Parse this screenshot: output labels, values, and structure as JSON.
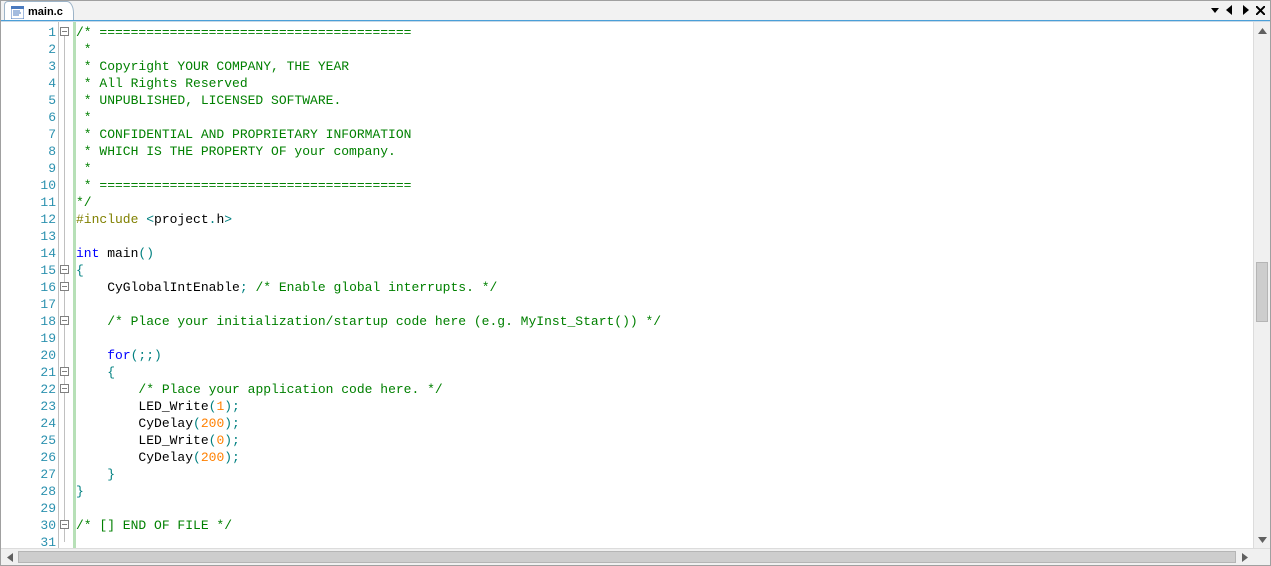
{
  "tab": {
    "label": "main.c",
    "icon": "c-src-icon"
  },
  "tab_controls": {
    "menu": "menu-down-icon",
    "prev": "tab-prev-icon",
    "next": "tab-next-icon",
    "close": "close-icon"
  },
  "gutter": {
    "start": 1,
    "end": 31
  },
  "fold_marks": [
    1,
    15,
    16,
    18,
    21,
    22,
    30
  ],
  "code_lines": [
    {
      "n": 1,
      "tokens": [
        [
          "comment",
          "/* ========================================"
        ]
      ]
    },
    {
      "n": 2,
      "tokens": [
        [
          "comment",
          " *"
        ]
      ]
    },
    {
      "n": 3,
      "tokens": [
        [
          "comment",
          " * Copyright YOUR COMPANY, THE YEAR"
        ]
      ]
    },
    {
      "n": 4,
      "tokens": [
        [
          "comment",
          " * All Rights Reserved"
        ]
      ]
    },
    {
      "n": 5,
      "tokens": [
        [
          "comment",
          " * UNPUBLISHED, LICENSED SOFTWARE."
        ]
      ]
    },
    {
      "n": 6,
      "tokens": [
        [
          "comment",
          " *"
        ]
      ]
    },
    {
      "n": 7,
      "tokens": [
        [
          "comment",
          " * CONFIDENTIAL AND PROPRIETARY INFORMATION"
        ]
      ]
    },
    {
      "n": 8,
      "tokens": [
        [
          "comment",
          " * WHICH IS THE PROPERTY OF your company."
        ]
      ]
    },
    {
      "n": 9,
      "tokens": [
        [
          "comment",
          " *"
        ]
      ]
    },
    {
      "n": 10,
      "tokens": [
        [
          "comment",
          " * ========================================"
        ]
      ]
    },
    {
      "n": 11,
      "tokens": [
        [
          "comment",
          "*/"
        ]
      ]
    },
    {
      "n": 12,
      "tokens": [
        [
          "preproc",
          "#include "
        ],
        [
          "punct",
          "<"
        ],
        [
          "ident",
          "project"
        ],
        [
          "punct",
          "."
        ],
        [
          "ident",
          "h"
        ],
        [
          "punct",
          ">"
        ]
      ]
    },
    {
      "n": 13,
      "tokens": [
        [
          "ident",
          ""
        ]
      ]
    },
    {
      "n": 14,
      "tokens": [
        [
          "keyword",
          "int"
        ],
        [
          "ident",
          " main"
        ],
        [
          "punct",
          "()"
        ]
      ]
    },
    {
      "n": 15,
      "tokens": [
        [
          "punct",
          "{"
        ]
      ]
    },
    {
      "n": 16,
      "tokens": [
        [
          "ident",
          "    CyGlobalIntEnable"
        ],
        [
          "punct",
          ";"
        ],
        [
          "ident",
          " "
        ],
        [
          "comment",
          "/* Enable global interrupts. */"
        ]
      ]
    },
    {
      "n": 17,
      "tokens": [
        [
          "ident",
          ""
        ]
      ]
    },
    {
      "n": 18,
      "tokens": [
        [
          "ident",
          "    "
        ],
        [
          "comment",
          "/* Place your initialization/startup code here (e.g. MyInst_Start()) */"
        ]
      ]
    },
    {
      "n": 19,
      "tokens": [
        [
          "ident",
          ""
        ]
      ]
    },
    {
      "n": 20,
      "tokens": [
        [
          "ident",
          "    "
        ],
        [
          "keyword",
          "for"
        ],
        [
          "punct",
          "(;;)"
        ]
      ]
    },
    {
      "n": 21,
      "tokens": [
        [
          "ident",
          "    "
        ],
        [
          "punct",
          "{"
        ]
      ]
    },
    {
      "n": 22,
      "tokens": [
        [
          "ident",
          "        "
        ],
        [
          "comment",
          "/* Place your application code here. */"
        ]
      ]
    },
    {
      "n": 23,
      "tokens": [
        [
          "ident",
          "        LED_Write"
        ],
        [
          "punct",
          "("
        ],
        [
          "number",
          "1"
        ],
        [
          "punct",
          ");"
        ]
      ]
    },
    {
      "n": 24,
      "tokens": [
        [
          "ident",
          "        CyDelay"
        ],
        [
          "punct",
          "("
        ],
        [
          "number",
          "200"
        ],
        [
          "punct",
          ");"
        ]
      ]
    },
    {
      "n": 25,
      "tokens": [
        [
          "ident",
          "        LED_Write"
        ],
        [
          "punct",
          "("
        ],
        [
          "number",
          "0"
        ],
        [
          "punct",
          ");"
        ]
      ]
    },
    {
      "n": 26,
      "tokens": [
        [
          "ident",
          "        CyDelay"
        ],
        [
          "punct",
          "("
        ],
        [
          "number",
          "200"
        ],
        [
          "punct",
          ");"
        ]
      ]
    },
    {
      "n": 27,
      "tokens": [
        [
          "ident",
          "    "
        ],
        [
          "punct",
          "}"
        ]
      ]
    },
    {
      "n": 28,
      "tokens": [
        [
          "punct",
          "}"
        ]
      ]
    },
    {
      "n": 29,
      "tokens": [
        [
          "ident",
          ""
        ]
      ]
    },
    {
      "n": 30,
      "tokens": [
        [
          "comment",
          "/* [] END OF FILE */"
        ]
      ]
    },
    {
      "n": 31,
      "tokens": [
        [
          "ident",
          ""
        ]
      ]
    }
  ]
}
